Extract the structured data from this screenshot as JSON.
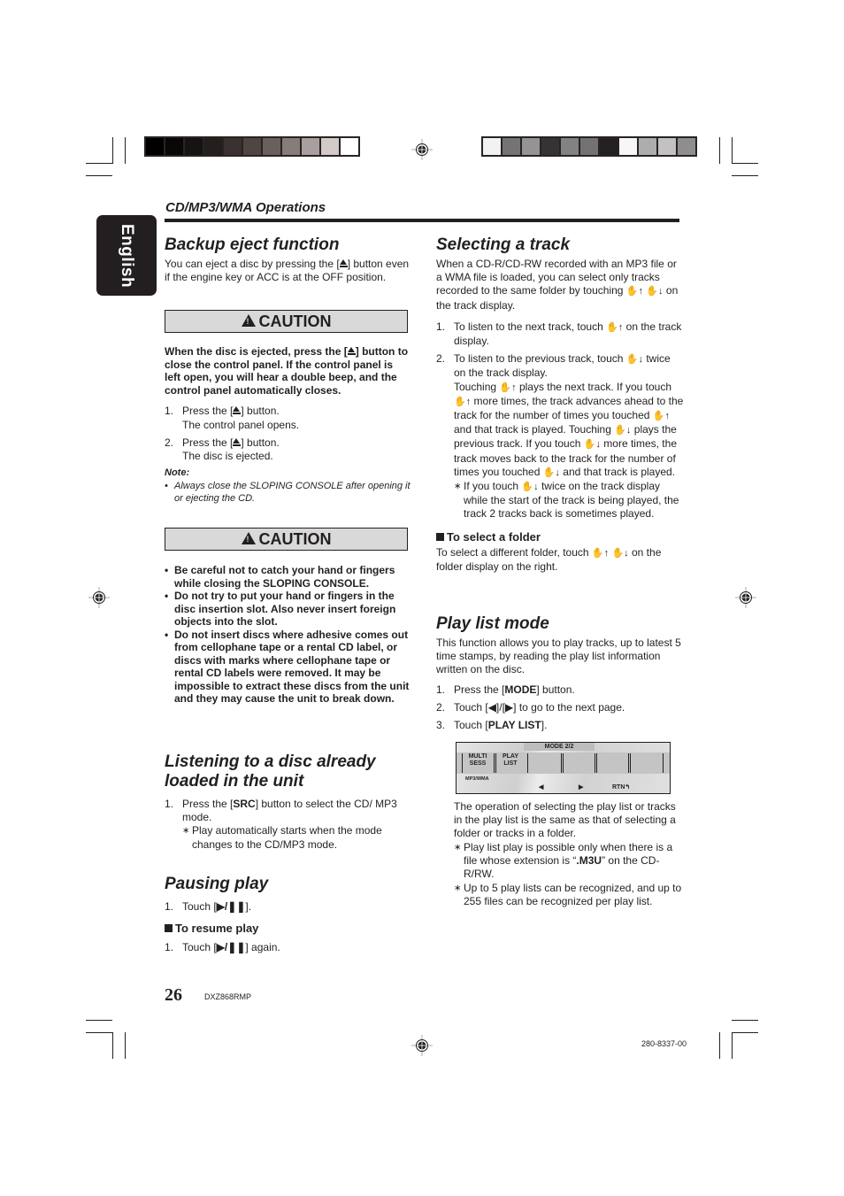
{
  "header": {
    "section_title": "CD/MP3/WMA Operations",
    "language_tab": "English"
  },
  "colors": {
    "ink": "#231f20",
    "caution_bg": "#d9d9d9",
    "colorbar_left": [
      "#000000",
      "#0a0807",
      "#161312",
      "#231f1d",
      "#393130",
      "#4f4543",
      "#6a5f5c",
      "#887c7a",
      "#a89f9e",
      "#d2cac9",
      "#ffffff"
    ],
    "colorbar_right": [
      "#f2f2f2",
      "#747474",
      "#949494",
      "#363334",
      "#828282",
      "#727272",
      "#242021",
      "#f7f7f7",
      "#adadad",
      "#c2c2c2",
      "#8e8e8e"
    ]
  },
  "backup_eject": {
    "title": "Backup eject function",
    "intro_a": "You can eject a disc by pressing the [",
    "intro_b": "] button even if the engine key or ACC is at the OFF position.",
    "caution_label": "CAUTION",
    "caution_text_a": "When the disc is ejected, press the [",
    "caution_text_b": "] button to close the control panel. If the control panel is left open, you will hear a double beep, and the control panel automatically closes.",
    "steps": [
      {
        "num": "1.",
        "a": "Press the [",
        "b": "] button.",
        "sub": "The control panel opens."
      },
      {
        "num": "2.",
        "a": "Press the [",
        "b": "] button.",
        "sub": "The disc is ejected."
      }
    ],
    "note_label": "Note:",
    "note_text": "Always close the SLOPING CONSOLE after opening it or ejecting the CD."
  },
  "caution2": {
    "label": "CAUTION",
    "bullets": [
      "Be careful not to catch your hand or fingers while closing the SLOPING CONSOLE.",
      "Do not try to put your hand or fingers in the disc insertion slot. Also never insert foreign objects into the slot.",
      "Do not insert discs where adhesive comes out from cellophane tape or a rental CD label, or discs with marks where cellophane tape or rental CD labels were removed. It may be impossible to extract these discs from the unit and they may cause the unit to break down."
    ]
  },
  "listening": {
    "title_line1": "Listening to a disc already",
    "title_line2": "loaded in the unit",
    "step_num": "1.",
    "step_a": "Press the [",
    "step_bold": "SRC",
    "step_b": "] button to select the CD/ MP3 mode.",
    "note": "Play automatically starts when the mode changes to the CD/MP3 mode."
  },
  "pausing": {
    "title": "Pausing play",
    "step_num": "1.",
    "step_a": "Touch [",
    "symbol": "▶/❚❚",
    "step_b": "].",
    "resume_heading": "To resume play",
    "resume_num": "1.",
    "resume_a": "Touch [",
    "resume_b": "] again."
  },
  "selecting": {
    "title": "Selecting a track",
    "intro_a": "When a CD-R/CD-RW recorded with an MP3 file or a WMA file is loaded, you can select only tracks recorded to the same folder by touching",
    "intro_b": "on the track display.",
    "sym_up": "✋↑",
    "sym_down": "✋↓",
    "step1_num": "1.",
    "step1_a": "To listen to the next track, touch",
    "step1_b": "on the track display.",
    "step2_num": "2.",
    "step2_a": "To listen to the previous track, touch",
    "step2_b": "twice on the track display.",
    "p1": "Touching",
    "p2": "plays the next track. If you touch",
    "p3": "more times, the track advances ahead to the track for the number of times you touched",
    "p4": "and that track is played. Touching",
    "p5": "plays the previous track. If you touch",
    "p6": "more times, the track moves back to the track for the number of times you touched",
    "p7": "and that track is played.",
    "note_a": "If you touch",
    "note_b": "twice on the track display while the start of the track is being played, the track 2 tracks back is sometimes played.",
    "folder_heading": "To select a folder",
    "folder_a": "To select a different folder, touch",
    "folder_b": "on the folder display on the right."
  },
  "playlist": {
    "title": "Play list mode",
    "intro": "This function allows you to play tracks, up to latest 5 time stamps, by reading the play list information written on the disc.",
    "steps": [
      {
        "num": "1.",
        "a": "Press the [",
        "bold": "MODE",
        "b": "] button."
      },
      {
        "num": "2.",
        "a": "Touch [◀]/[▶] to go to the next page."
      },
      {
        "num": "3.",
        "a": "Touch [",
        "bold": "PLAY LIST",
        "b": "]."
      }
    ],
    "display": {
      "mode": "MODE 2/2",
      "btn1_line1": "MULTI",
      "btn1_line2": "SESS",
      "btn2_line1": "PLAY",
      "btn2_line2": "LIST",
      "mp3wma": "MP3/WMA",
      "prev": "◀",
      "next": "▶",
      "rtn": "RTN↰"
    },
    "after": "The operation of selecting the play list or tracks in the play list is the same as that of selecting a folder or tracks in a folder.",
    "note1_a": "Play list play is possible only when there is a file whose extension is “",
    "note1_bold": ".M3U",
    "note1_b": "” on the CD-R/RW.",
    "note2": "Up to 5 play lists can be recognized, and up to 255 files can be recognized per play list."
  },
  "footer": {
    "page_number": "26",
    "model": "DXZ868RMP",
    "code": "280-8337-00"
  }
}
